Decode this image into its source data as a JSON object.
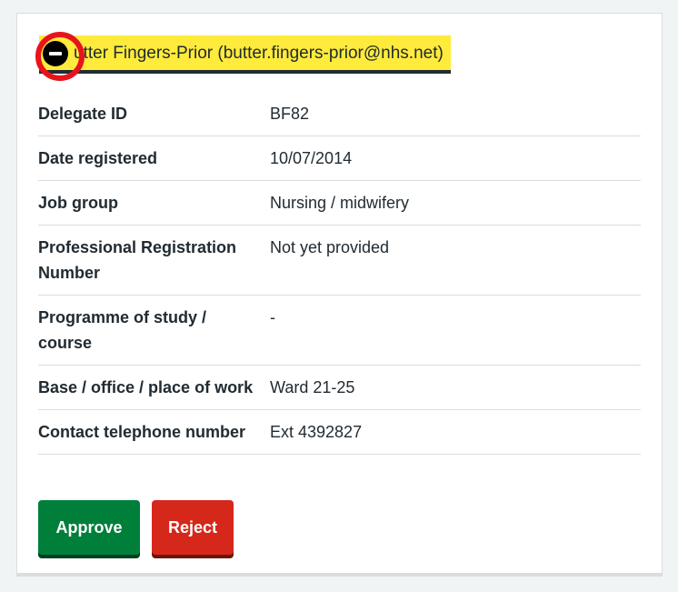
{
  "summary": {
    "title": "Butter Fingers-Prior (butter.fingers-prior@nhs.net)",
    "visible_title": "utter Fingers-Prior (butter.fingers-prior@nhs.net)"
  },
  "details": [
    {
      "label": "Delegate ID",
      "value": "BF82"
    },
    {
      "label": "Date registered",
      "value": "10/07/2014"
    },
    {
      "label": "Job group",
      "value": "Nursing / midwifery"
    },
    {
      "label": "Professional Registration Number",
      "value": "Not yet provided"
    },
    {
      "label": "Programme of study / course",
      "value": "-"
    },
    {
      "label": "Base / office / place of work",
      "value": "Ward 21-25"
    },
    {
      "label": "Contact telephone number",
      "value": "Ext 4392827"
    }
  ],
  "actions": {
    "approve_label": "Approve",
    "reject_label": "Reject"
  },
  "colors": {
    "focus_highlight": "#ffeb3b",
    "approve": "#007f3b",
    "reject": "#d5281b",
    "annotation_ring": "#e8141c"
  },
  "icons": {
    "toggle": "minus-circle-icon"
  }
}
